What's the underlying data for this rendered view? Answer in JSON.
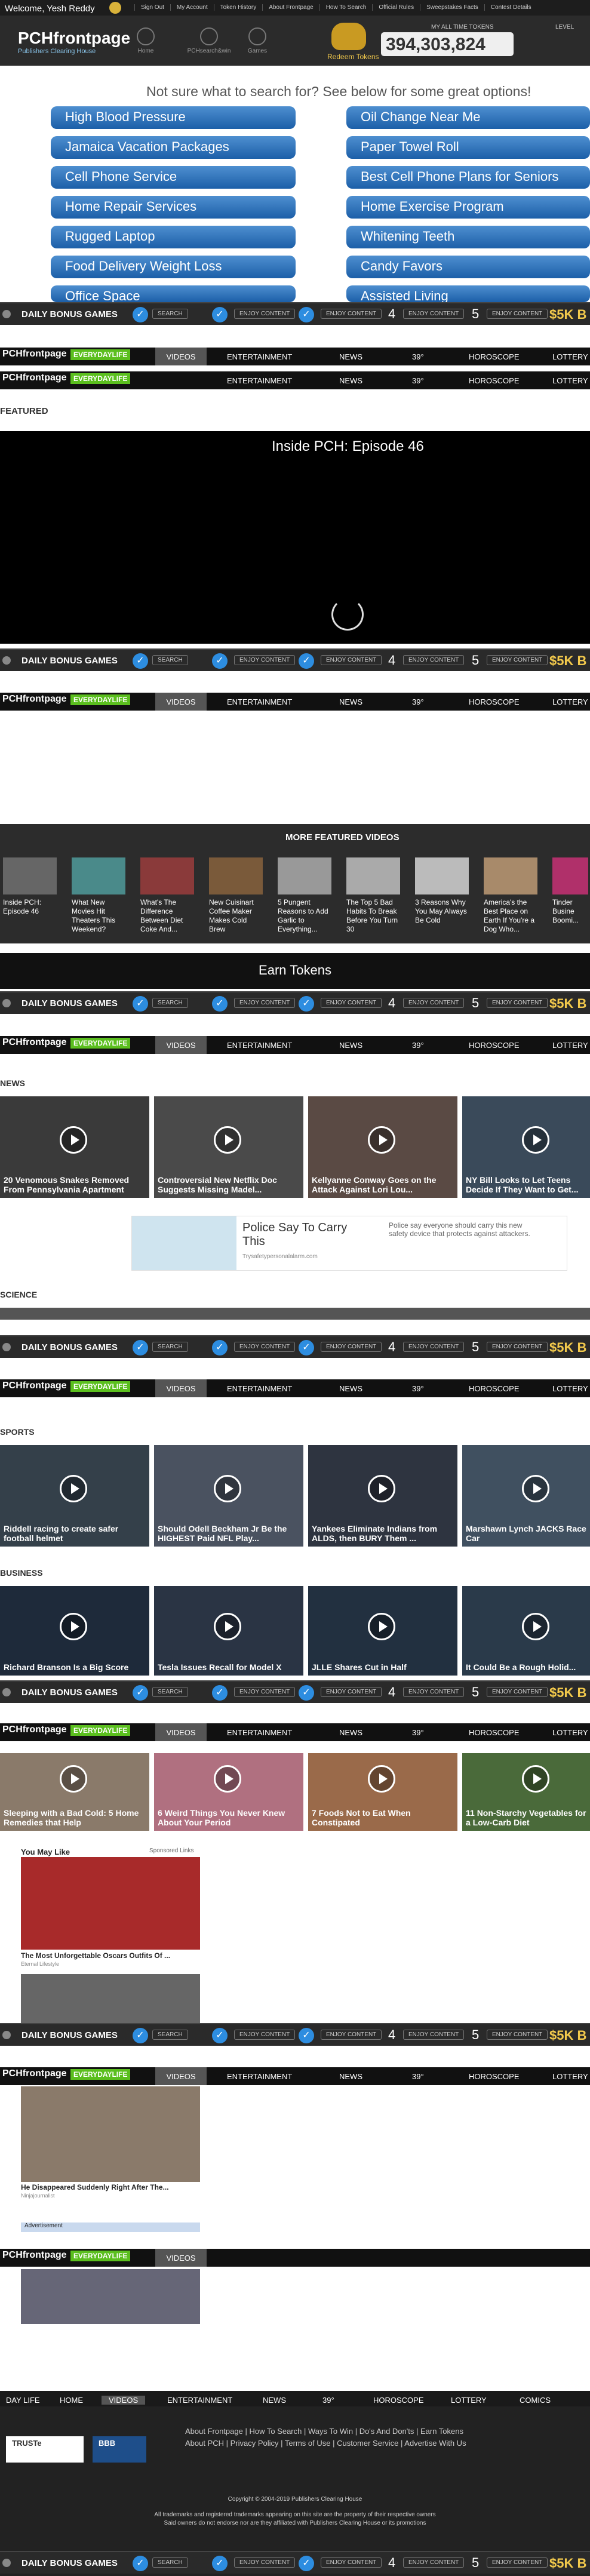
{
  "util": {
    "welcome": "Welcome, Yesh Reddy",
    "links": [
      "Sign Out",
      "My Account",
      "Token History",
      "About Frontpage",
      "How To Search",
      "Official Rules",
      "Sweepstakes Facts",
      "Contest Details"
    ]
  },
  "header": {
    "logo": "PCHfrontpage",
    "logo_sub": "Publishers Clearing House",
    "icons": [
      "Home",
      "PCHsearch&win",
      "Games"
    ],
    "redeem": "Redeem Tokens",
    "tokens_label": "MY ALL TIME TOKENS",
    "tokens": "394,303,824",
    "level_label": "LEVEL"
  },
  "suggest": {
    "heading": "Not sure what to search for? See below for some great options!",
    "left": [
      "High Blood Pressure",
      "Jamaica Vacation Packages",
      "Cell Phone Service",
      "Home Repair Services",
      "Rugged Laptop",
      "Food Delivery Weight Loss",
      "Office Space"
    ],
    "right": [
      "Oil Change Near Me",
      "Paper Towel Roll",
      "Best Cell Phone Plans for Seniors",
      "Home Exercise Program",
      "Whitening Teeth",
      "Candy Favors",
      "Assisted Living"
    ]
  },
  "bonus": {
    "title": "DAILY BONUS GAMES",
    "labels": [
      "SEARCH",
      "ENJOY CONTENT",
      "ENJOY CONTENT",
      "ENJOY CONTENT",
      "ENJOY CONTENT",
      "ENJOY CONTENT"
    ],
    "nums": [
      "4",
      "5"
    ],
    "prize": "$5K B"
  },
  "nav": {
    "logo": "PCHfrontpage",
    "edl": "EVERYDAYLIFE",
    "video": "VIDEOS",
    "items": [
      "ENTERTAINMENT",
      "NEWS",
      "39°",
      "HOROSCOPE",
      "LOTTERY"
    ]
  },
  "featured": {
    "heading": "FEATURED",
    "video_title": "Inside PCH: Episode 46",
    "more": "MORE FEATURED VIDEOS",
    "videos": [
      "Inside PCH: Episode 46",
      "What New Movies Hit Theaters This Weekend?",
      "What's The Difference Between Diet Coke And...",
      "New Cuisinart Coffee Maker Makes Cold Brew",
      "5 Pungent Reasons to Add Garlic to Everything...",
      "The Top 5 Bad Habits To Break Before You Turn 30",
      "3 Reasons Why You May Always Be Cold",
      "America's the Best Place on Earth If You're a Dog Who...",
      "Tinder Busine Boomi..."
    ]
  },
  "earn": "Earn Tokens",
  "sections": {
    "news": "NEWS",
    "news_cards": [
      "20 Venomous Snakes Removed From Pennsylvania Apartment",
      "Controversial New Netflix Doc Suggests Missing Madel...",
      "Kellyanne Conway Goes on the Attack Against Lori Lou...",
      "NY Bill Looks to Let Teens Decide If They Want to Get..."
    ],
    "ad_title": "Police Say To Carry This",
    "ad_url": "Trysafetypersonalalarm.com",
    "ad_text": "Police say everyone should carry this new safety device that protects against attackers.",
    "science": "SCIENCE",
    "sports": "SPORTS",
    "sports_cards": [
      "Riddell racing to create safer football helmet",
      "Should Odell Beckham Jr Be the HIGHEST Paid NFL Play...",
      "Yankees Eliminate Indians from ALDS, then BURY Them ...",
      "Marshawn Lynch JACKS Race Car"
    ],
    "business": "BUSINESS",
    "business_cards": [
      "Richard Branson Is a Big Score",
      "Tesla Issues Recall for Model X",
      "JLLE Shares Cut in Half",
      "It Could Be a Rough Holid..."
    ],
    "health_cards": [
      "Sleeping with a Bad Cold: 5 Home Remedies that Help",
      "6 Weird Things You Never Knew About Your Period",
      "7 Foods Not to Eat When Constipated",
      "11 Non-Starchy Vegetables for a Low-Carb Diet"
    ]
  },
  "sponsored": {
    "head": "You May Like",
    "tag": "Sponsored Links",
    "items": [
      "The Most Unforgettable Oscars Outfits Of ...",
      "He Disappeared Suddenly Right After The..."
    ],
    "sources": [
      "Eternal Lifestyle",
      "Ninjajournalist"
    ],
    "advert": "Advertisement"
  },
  "footer": {
    "nav": [
      "DAY LIFE",
      "HOME",
      "VIDEOS",
      "ENTERTAINMENT",
      "NEWS",
      "39°",
      "HOROSCOPE",
      "LOTTERY",
      "COMICS"
    ],
    "links1": "About Frontpage  |  How To Search  |  Ways To Win  |  Do's And Don'ts  |  Earn Tokens",
    "links2": "About PCH  |  Privacy Policy  |  Terms of Use  |  Customer Service  |  Advertise With Us",
    "copyright": "Copyright © 2004-2019 Publishers Clearing House",
    "trademark": "All trademarks and registered trademarks appearing on this site are the property of their respective owners",
    "disclaimer": "Said owners do not endorse nor are they affiliated with Publishers Clearing House or its promotions",
    "truste": "TRUSTe",
    "bbb": "BBB"
  },
  "colors": {
    "accent": "#2d8de0",
    "nav": "#111111",
    "gold": "#f2c94c",
    "pill": "#2a6fbb"
  }
}
